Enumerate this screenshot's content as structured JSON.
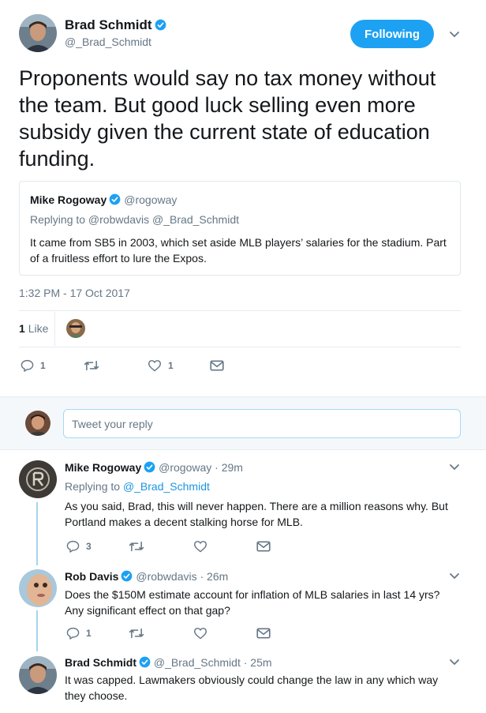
{
  "main_tweet": {
    "author_name": "Brad Schmidt",
    "author_handle": "@_Brad_Schmidt",
    "follow_label": "Following",
    "text": "Proponents would say no tax money without the team. But good luck selling even more subsidy given the current state of education funding.",
    "quoted": {
      "author_name": "Mike Rogoway",
      "author_handle": "@rogoway",
      "replying_to": "Replying to @robwdavis @_Brad_Schmidt",
      "text": "It came from SB5 in 2003, which set aside MLB players’ salaries for the stadium. Part of a fruitless effort to lure the Expos."
    },
    "timestamp": "1:32 PM - 17 Oct 2017",
    "like_count": "1",
    "like_label": "Like",
    "actions": {
      "reply_count": "1",
      "retweet_count": "",
      "like_count": "1"
    }
  },
  "reply_box": {
    "placeholder": "Tweet your reply"
  },
  "replies": [
    {
      "author_name": "Mike Rogoway",
      "meta": "@rogoway · 29m",
      "replying_prefix": "Replying to ",
      "replying_handle": "@_Brad_Schmidt",
      "text": "As you said, Brad, this will never happen. There are a million reasons why. But Portland makes a decent stalking horse for MLB.",
      "reply_count": "3",
      "retweet_count": "",
      "like_count": ""
    },
    {
      "author_name": "Rob Davis",
      "meta": "@robwdavis · 26m",
      "text": "Does the $150M estimate account for inflation of MLB salaries in last 14 yrs? Any significant effect on that gap?",
      "reply_count": "1",
      "retweet_count": "",
      "like_count": ""
    },
    {
      "author_name": "Brad Schmidt",
      "meta": "@_Brad_Schmidt · 25m",
      "text": "It was capped. Lawmakers obviously could change the law in any which way they choose."
    }
  ],
  "colors": {
    "accent": "#1da1f2",
    "link": "#1b95e0",
    "verified": "#1da1f2",
    "secondary_text": "#657786",
    "thread_line": "#a5d4ee"
  }
}
